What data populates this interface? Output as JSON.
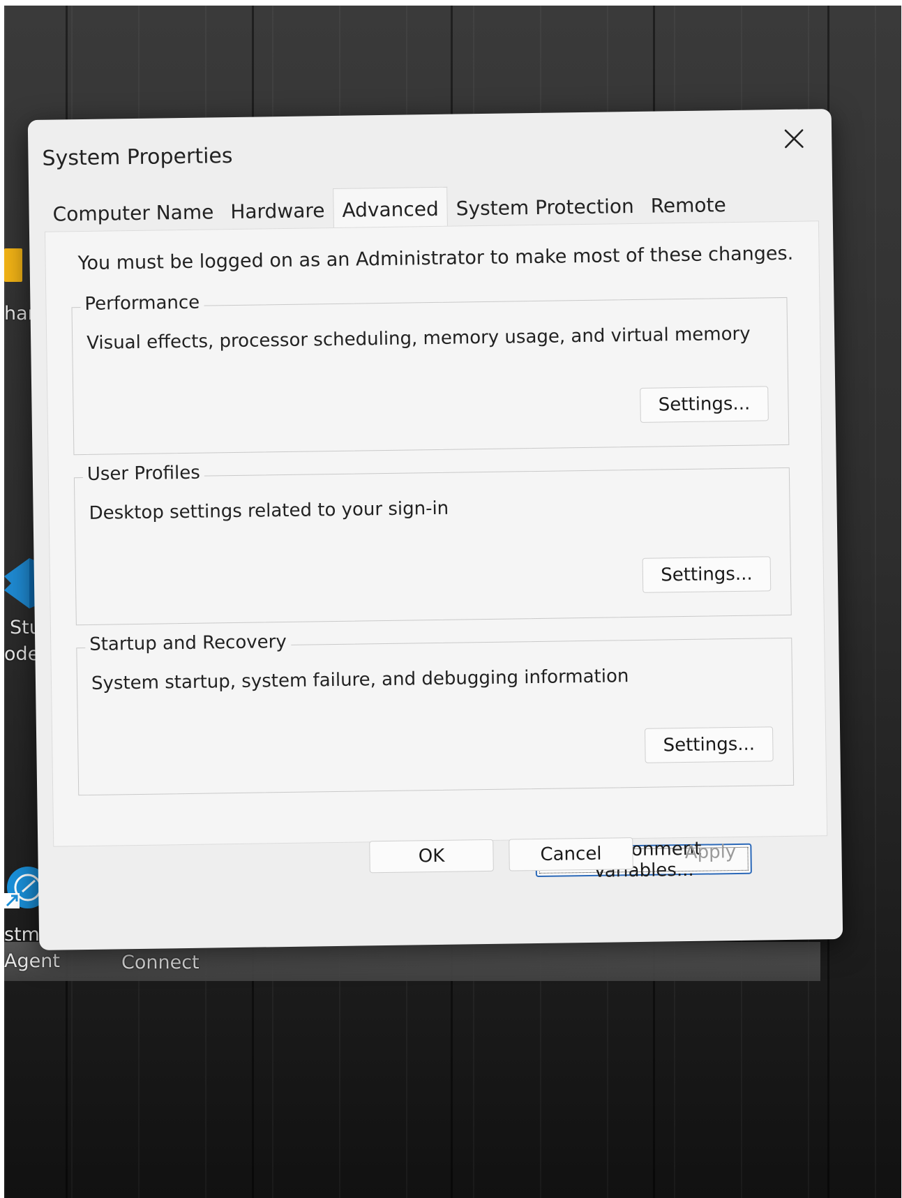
{
  "desktop": {
    "labels": [
      "hang",
      "Stud",
      "ode",
      "stman",
      "Agent",
      "Connect"
    ]
  },
  "dialog": {
    "title": "System Properties",
    "close_icon": "close-icon",
    "tabs": [
      {
        "label": "Computer Name",
        "active": false
      },
      {
        "label": "Hardware",
        "active": false
      },
      {
        "label": "Advanced",
        "active": true
      },
      {
        "label": "System Protection",
        "active": false
      },
      {
        "label": "Remote",
        "active": false
      }
    ],
    "notice": "You must be logged on as an Administrator to make most of these changes.",
    "groups": [
      {
        "legend": "Performance",
        "description": "Visual effects, processor scheduling, memory usage, and virtual memory",
        "button": "Settings..."
      },
      {
        "legend": "User Profiles",
        "description": "Desktop settings related to your sign-in",
        "button": "Settings..."
      },
      {
        "legend": "Startup and Recovery",
        "description": "System startup, system failure, and debugging information",
        "button": "Settings..."
      }
    ],
    "env_button": "Environment Variables...",
    "ok_button": "OK",
    "cancel_button": "Cancel",
    "apply_button": "Apply"
  },
  "colors": {
    "dialog_bg": "#eeeeee",
    "focus_border": "#2a68b8",
    "disabled_text": "#9a9a9a",
    "vscode_blue": "#1f8ad2",
    "postman_blue": "#1a8fd8",
    "folder_yellow": "#f2b316"
  }
}
